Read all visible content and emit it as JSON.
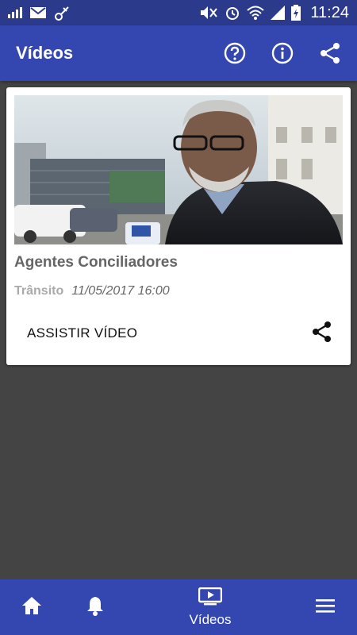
{
  "status_bar": {
    "time": "11:24",
    "icons": [
      "signal-bars-icon",
      "mail-icon",
      "usb-icon",
      "mute-icon",
      "alarm-icon",
      "wifi-icon",
      "cell-signal-icon",
      "battery-charging-icon"
    ]
  },
  "app_bar": {
    "title": "Vídeos",
    "actions": [
      "help-icon",
      "info-icon",
      "share-icon"
    ],
    "color": "#3446b0"
  },
  "video_card": {
    "title": "Agentes Conciliadores",
    "category": "Trânsito",
    "datetime": "11/05/2017 16:00",
    "watch_label": "ASSISTIR VÍDEO",
    "share_icon": "share-icon",
    "thumbnail_icon": "video-thumbnail"
  },
  "bottom_nav": {
    "items": [
      {
        "icon": "home-icon",
        "label": ""
      },
      {
        "icon": "bell-icon",
        "label": ""
      },
      {
        "icon": "video-icon",
        "label": "Vídeos"
      },
      {
        "icon": "menu-icon",
        "label": ""
      }
    ]
  }
}
